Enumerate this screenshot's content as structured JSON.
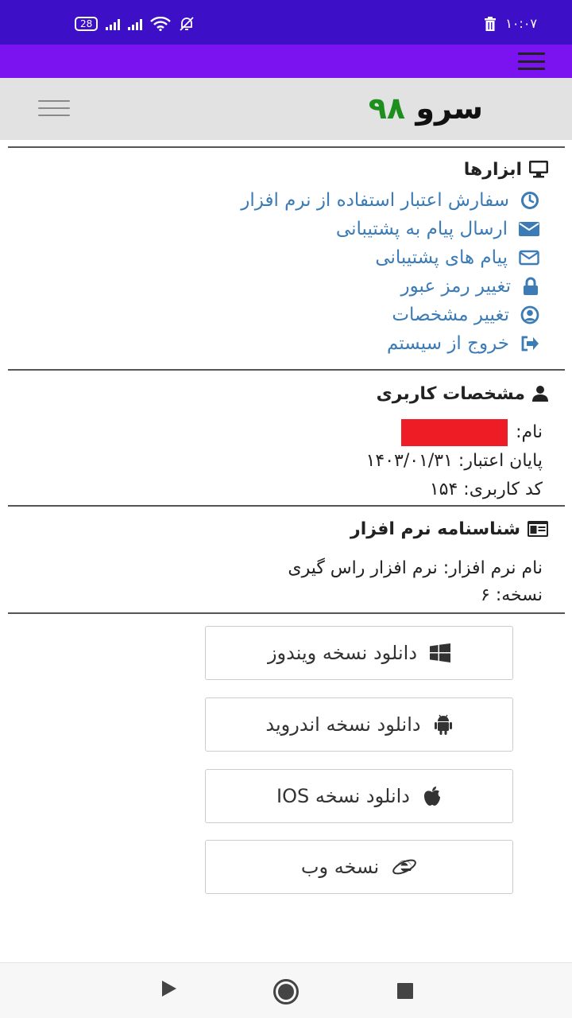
{
  "status_bar": {
    "battery": "28",
    "signal_1_label": "",
    "time": "۱۰:۰۷"
  },
  "header": {
    "brand_part1": "سرو",
    "brand_part2": "۹۸"
  },
  "tools": {
    "title": "ابزارها",
    "items": [
      {
        "label": "سفارش اعتبار استفاده از نرم افزار",
        "icon": "clock-icon"
      },
      {
        "label": "ارسال پیام به پشتیبانی",
        "icon": "envelope-filled-icon"
      },
      {
        "label": "پیام های پشتیبانی",
        "icon": "envelope-outline-icon"
      },
      {
        "label": "تغییر رمز عبور",
        "icon": "lock-icon"
      },
      {
        "label": "تغییر مشخصات",
        "icon": "user-circle-icon"
      },
      {
        "label": "خروج از سیستم",
        "icon": "sign-out-icon"
      }
    ]
  },
  "user": {
    "title": "مشخصات کاربری",
    "name_label": "نام:",
    "expiry": "پایان اعتبار: ۱۴۰۳/۰۱/۳۱",
    "user_code": "کد کاربری: ۱۵۴"
  },
  "software": {
    "title": "شناسنامه نرم افزار",
    "name": "نام نرم افزار: نرم افزار راس گیری",
    "version": "نسخه: ۶"
  },
  "downloads": {
    "windows": "دانلود نسخه ویندوز",
    "android": "دانلود نسخه اندروید",
    "ios": "دانلود نسخه IOS",
    "web": "نسخه وب"
  },
  "colors": {
    "status_bar": "#3d10c8",
    "app_bar": "#7b12f0",
    "link": "#3b7bb6",
    "brand_green": "#1d8f1d",
    "redaction": "#ee1c25"
  }
}
